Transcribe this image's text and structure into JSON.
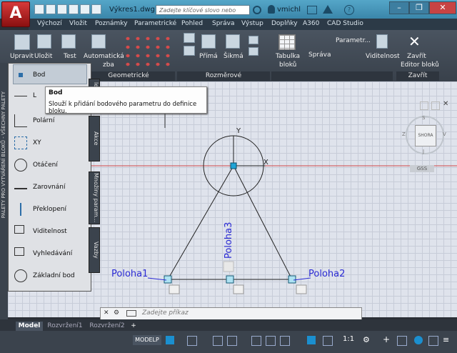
{
  "app": {
    "logo_letter": "A",
    "doc_title": "Výkres1.dwg",
    "search_placeholder": "Zadejte klíčové slovo nebo výraz.",
    "user": "vmichl"
  },
  "window_controls": [
    "–",
    "❐",
    "✕"
  ],
  "menu_tabs": [
    "Výchozí",
    "Vložit",
    "Poznámky",
    "Parametrické",
    "Pohled",
    "Správa",
    "Výstup",
    "Doplňky",
    "A360",
    "CAD Studio"
  ],
  "ribbon": {
    "buttons": {
      "upravit": "Upravit",
      "ulozit": "Uložit",
      "test": "Test",
      "automaticka": "Automatická",
      "zba": "zba",
      "prima": "Přímá",
      "sikma": "Šikmá",
      "tabulka": "Tabulka",
      "bloku": "bloků",
      "sprava": "Správa",
      "parametr": "Parametr...",
      "viditelnost": "Viditelnost",
      "zavrit": "Zavřít",
      "editor_bloku": "Editor bloků"
    },
    "panels": {
      "geometricke": "Geometrické",
      "rozmerove": "Rozměrové",
      "zavrit": "Zavřít"
    }
  },
  "palette": {
    "side_title": "PALETY PRO VYTVÁŘENÍ BLOKŮ - VŠECHNY PALETY",
    "items": [
      {
        "label": "Bod"
      },
      {
        "label": "L"
      },
      {
        "label": "Polární"
      },
      {
        "label": "XY"
      },
      {
        "label": "Otáčení"
      },
      {
        "label": "Zarovnání"
      },
      {
        "label": "Překlopení"
      },
      {
        "label": "Viditelnost"
      },
      {
        "label": "Vyhledávání"
      },
      {
        "label": "Základní bod"
      }
    ],
    "tabs": [
      "Akce",
      "Množiny param...",
      "Vazby"
    ],
    "top_tab": "lety"
  },
  "tooltip": {
    "title": "Bod",
    "text": "Slouží k přidání bodového parametru do definice bloku."
  },
  "drawing": {
    "label_left": "Poloha1",
    "label_right": "Poloha2",
    "label_vertical": "Poloha3",
    "axis_y": "Y",
    "axis_x": "X"
  },
  "viewcube": {
    "north": "S",
    "east": "V",
    "west": "Z",
    "south": "J",
    "center": "SHORA",
    "wcs": "GSS"
  },
  "command": {
    "placeholder": "Zadejte příkaz"
  },
  "layout_tabs": [
    "Model",
    "Rozvržení1",
    "Rozvržení2",
    "+"
  ],
  "status": {
    "modelp": "MODELP",
    "scale": "1:1"
  }
}
